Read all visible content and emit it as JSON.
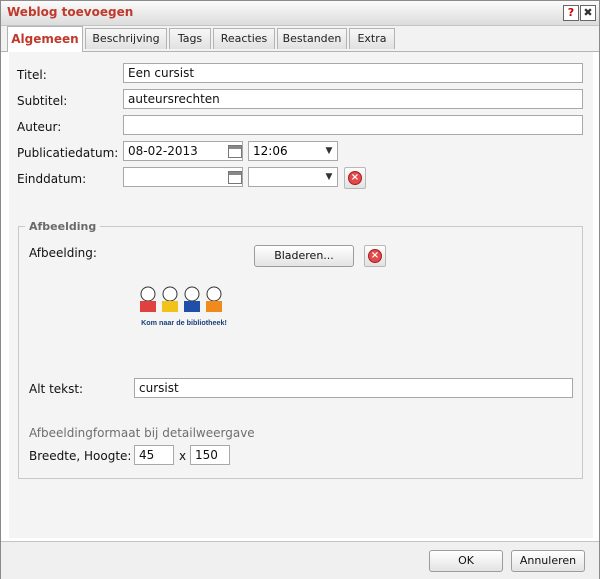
{
  "dialog": {
    "title": "Weblog toevoegen",
    "help_icon": "?",
    "close_icon": "✖"
  },
  "tabs": [
    {
      "label": "Algemeen",
      "active": true
    },
    {
      "label": "Beschrijving",
      "active": false
    },
    {
      "label": "Tags",
      "active": false
    },
    {
      "label": "Reacties",
      "active": false
    },
    {
      "label": "Bestanden",
      "active": false
    },
    {
      "label": "Extra",
      "active": false
    }
  ],
  "form": {
    "titel": {
      "label": "Titel:",
      "value": "Een cursist"
    },
    "subtitel": {
      "label": "Subtitel:",
      "value": "auteursrechten"
    },
    "auteur": {
      "label": "Auteur:",
      "value": ""
    },
    "publicatiedatum": {
      "label": "Publicatiedatum:",
      "date": "08-02-2013",
      "time": "12:06"
    },
    "einddatum": {
      "label": "Einddatum:",
      "date": "",
      "time": ""
    }
  },
  "afbeelding": {
    "legend": "Afbeelding",
    "label": "Afbeelding:",
    "browse_label": "Bladeren...",
    "logo_caption": "Kom naar de bibliotheek!",
    "alt_label": "Alt tekst:",
    "alt_value": "cursist",
    "format_title": "Afbeeldingformaat bij detailweergave",
    "size_label": "Breedte, Hoogte:",
    "width": "45",
    "times": "x",
    "height": "150"
  },
  "footer": {
    "ok_label": "OK",
    "cancel_label": "Annuleren"
  },
  "colors": {
    "accent": "#c0392b",
    "panel": "#f4f4f4"
  }
}
